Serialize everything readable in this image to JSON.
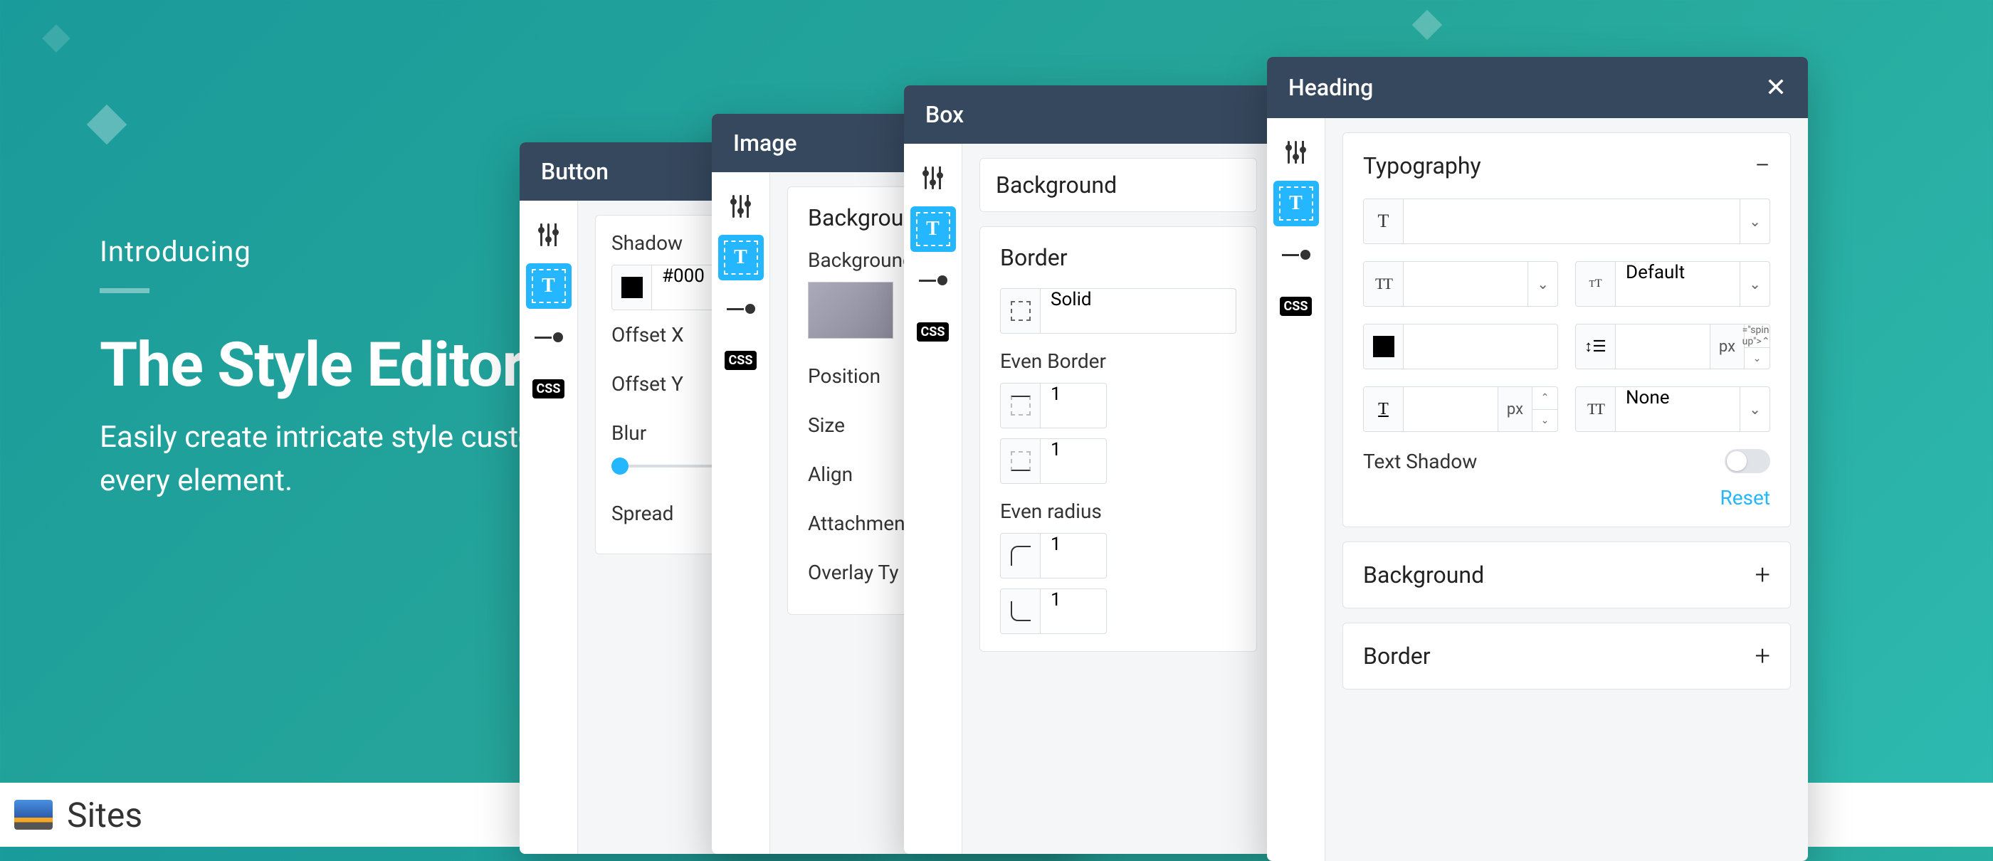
{
  "intro": {
    "eyebrow": "Introducing",
    "title": "The Style Editor",
    "subtitle": "Easily create intricate style customizations for every element."
  },
  "footer": {
    "product": "Sites"
  },
  "panels": {
    "button": {
      "title": "Button",
      "shadow_label": "Shadow",
      "color_hex": "#000",
      "offset_x": "Offset X",
      "offset_y": "Offset Y",
      "blur": "Blur",
      "spread": "Spread"
    },
    "image": {
      "title": "Image",
      "background": "Background",
      "background_image": "Background",
      "position": "Position",
      "size": "Size",
      "align": "Align",
      "attachment": "Attachment",
      "overlay": "Overlay Ty"
    },
    "box": {
      "title": "Box",
      "background": "Background",
      "border": "Border",
      "border_style": "Solid",
      "even_border": "Even Border",
      "val1": "1",
      "val2": "1",
      "even_radius": "Even radius",
      "val3": "1",
      "val4": "1"
    },
    "heading": {
      "title": "Heading",
      "typography": {
        "label": "Typography",
        "font_size_default": "Default",
        "line_unit": "px",
        "letter_unit": "px",
        "transform_none": "None",
        "text_shadow": "Text Shadow",
        "reset": "Reset"
      },
      "background": {
        "label": "Background"
      },
      "border": {
        "label": "Border"
      }
    },
    "side_css": "CSS"
  }
}
